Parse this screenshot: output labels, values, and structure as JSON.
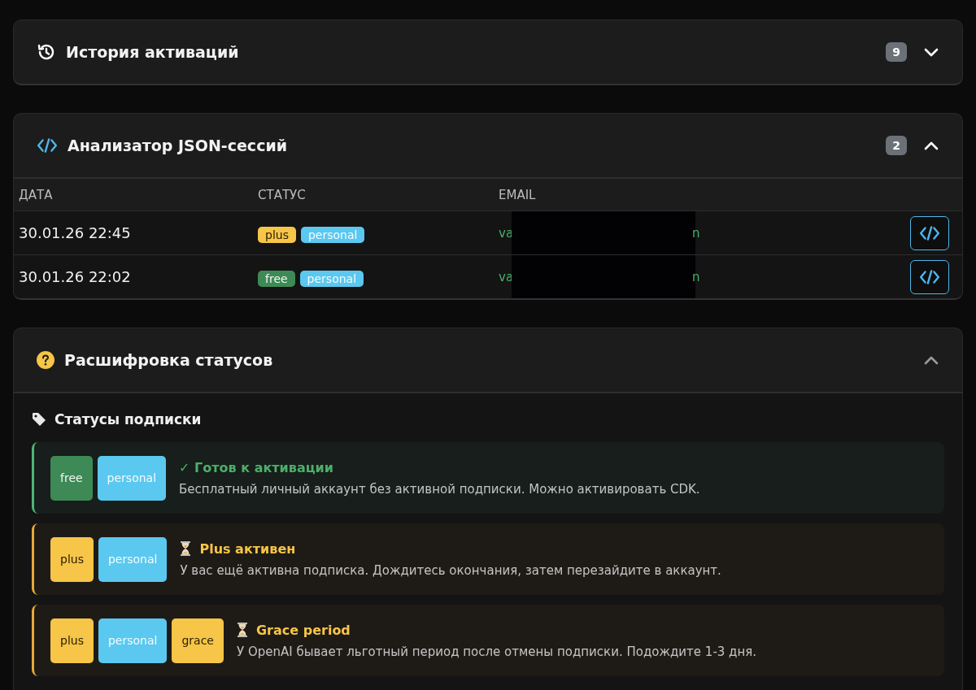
{
  "history": {
    "title": "История активаций",
    "count": "9",
    "expanded": false
  },
  "analyzer": {
    "title": "Анализатор JSON-сессий",
    "count": "2",
    "expanded": true,
    "columns": [
      "ДАТА",
      "СТАТУС",
      "EMAIL"
    ],
    "rows": [
      {
        "date": "30.01.26 22:45",
        "tags": [
          {
            "label": "plus",
            "kind": "plus"
          },
          {
            "label": "personal",
            "kind": "personal"
          }
        ],
        "email_start": "va",
        "email_end": "n"
      },
      {
        "date": "30.01.26 22:02",
        "tags": [
          {
            "label": "free",
            "kind": "free"
          },
          {
            "label": "personal",
            "kind": "personal"
          }
        ],
        "email_start": "va",
        "email_end": "n"
      }
    ]
  },
  "legend": {
    "title": "Расшифровка статусов",
    "expanded": true,
    "section_title": "Статусы подписки",
    "items": [
      {
        "kind": "ready",
        "tags": [
          {
            "label": "free",
            "kind": "free"
          },
          {
            "label": "personal",
            "kind": "personal"
          }
        ],
        "title": "✓ Готов к активации",
        "text": "Бесплатный личный аккаунт без активной подписки. Можно активировать CDK."
      },
      {
        "kind": "waiting",
        "tags": [
          {
            "label": "plus",
            "kind": "plus"
          },
          {
            "label": "personal",
            "kind": "personal"
          }
        ],
        "title": "Plus активен",
        "text": "У вас ещё активна подписка. Дождитесь окончания, затем перезайдите в аккаунт."
      },
      {
        "kind": "waiting",
        "tags": [
          {
            "label": "plus",
            "kind": "plus"
          },
          {
            "label": "personal",
            "kind": "personal"
          },
          {
            "label": "grace",
            "kind": "grace"
          }
        ],
        "title": "Grace period",
        "text": "У OpenAI бывает льготный период после отмены подписки. Подождите 1-3 дня."
      }
    ]
  }
}
